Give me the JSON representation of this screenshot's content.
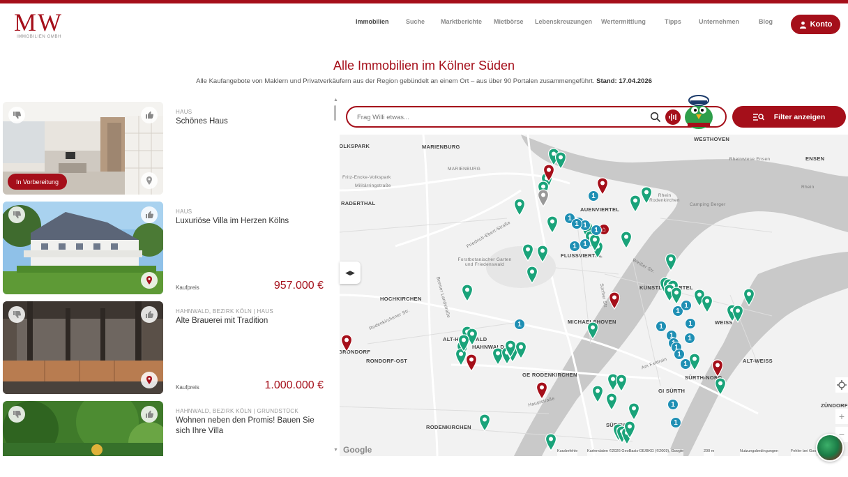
{
  "brand": {
    "logo_text": "MW",
    "logo_sub": "IMMOBILIEN GMBH",
    "accent": "#a50f1a",
    "pin_green": "#1aa37a",
    "cluster_blue": "#1f8fb4"
  },
  "nav": {
    "items": [
      "Immobilien",
      "Suche",
      "Marktberichte",
      "Mietbörse",
      "Lebenskreuzungen",
      "Wertermittlung",
      "Tipps",
      "Unternehmen",
      "Blog"
    ],
    "active": "Immobilien",
    "account_label": "Konto"
  },
  "page": {
    "title": "Alle Immobilien im Kölner Süden",
    "subtitle": "Alle Kaufangebote von Maklern und Privatverkäufern aus der Region gebündelt an einem Ort – aus über 90 Portalen zusammengeführt.",
    "stand": "Stand: 17.04.2026"
  },
  "listings": [
    {
      "meta": "HAUS",
      "title": "Schönes Haus",
      "status": "In Vorbereitung",
      "price_label": "",
      "price": ""
    },
    {
      "meta": "HAUS",
      "title": "Luxuriöse Villa im Herzen Kölns",
      "status": "",
      "price_label": "Kaufpreis",
      "price": "957.000 €"
    },
    {
      "meta": "HAHNWALD, BEZIRK KÖLN | HAUS",
      "title": "Alte Brauerei mit Tradition",
      "status": "",
      "price_label": "Kaufpreis",
      "price": "1.000.000 €"
    },
    {
      "meta": "HAHNWALD, BEZIRK KÖLN | GRUNDSTÜCK",
      "title": "Wohnen neben den Promis! Bauen Sie sich Ihre Villa",
      "status": "",
      "price_label": "",
      "price": ""
    }
  ],
  "search": {
    "placeholder": "Frag Willi etwas..."
  },
  "filter_button": "Filter anzeigen",
  "map": {
    "labels": [
      "VOLKSPARK",
      "MARIENBURG",
      "MARIENBURG",
      "Fritz-Encke-Volkspark",
      "Militärringstraße",
      "RADERTHAL",
      "Friedrich-Ebert-Straße",
      "Forstbotanischer Garten und Friedenswald",
      "HOCHKIRCHEN",
      "Bonner Landstraße",
      "Rodenkirchener Str.",
      "ALT-HAHNWALD",
      "HAHNWALD",
      "RONDORF-OST",
      "GRONDORF",
      "GE RODENKIRCHEN",
      "RODENKIRCHEN",
      "Hauptstraße",
      "AUENVIERTEL",
      "FLUSSVIERTEL",
      "MICHAELSHOVEN",
      "KÜNSTLERVIERTEL",
      "SÜRTH-NORD",
      "GI SÜRTH",
      "SÜRTH",
      "ALT-WEISS",
      "WEISS",
      "WESTHOVEN",
      "ENSEN",
      "Rheinwiese Ensen",
      "Rhein Rodenkirchen",
      "Camping Berger",
      "Rhein",
      "ZÜNDORF",
      "Am Feldrain",
      "Weißer Str.",
      "Sürther Str."
    ],
    "attribution": [
      "Kurzbefehle",
      "Kartendaten ©2026 GeoBasis-DE/BKG (©2009), Google",
      "200 m",
      "Nutzungsbedingungen",
      "Fehler bei Google melden"
    ],
    "google_logo": "Google",
    "cluster_value": "1",
    "pin_counts": {
      "green": 52,
      "red": 9,
      "grey": 1,
      "blue_clusters": 21
    }
  }
}
